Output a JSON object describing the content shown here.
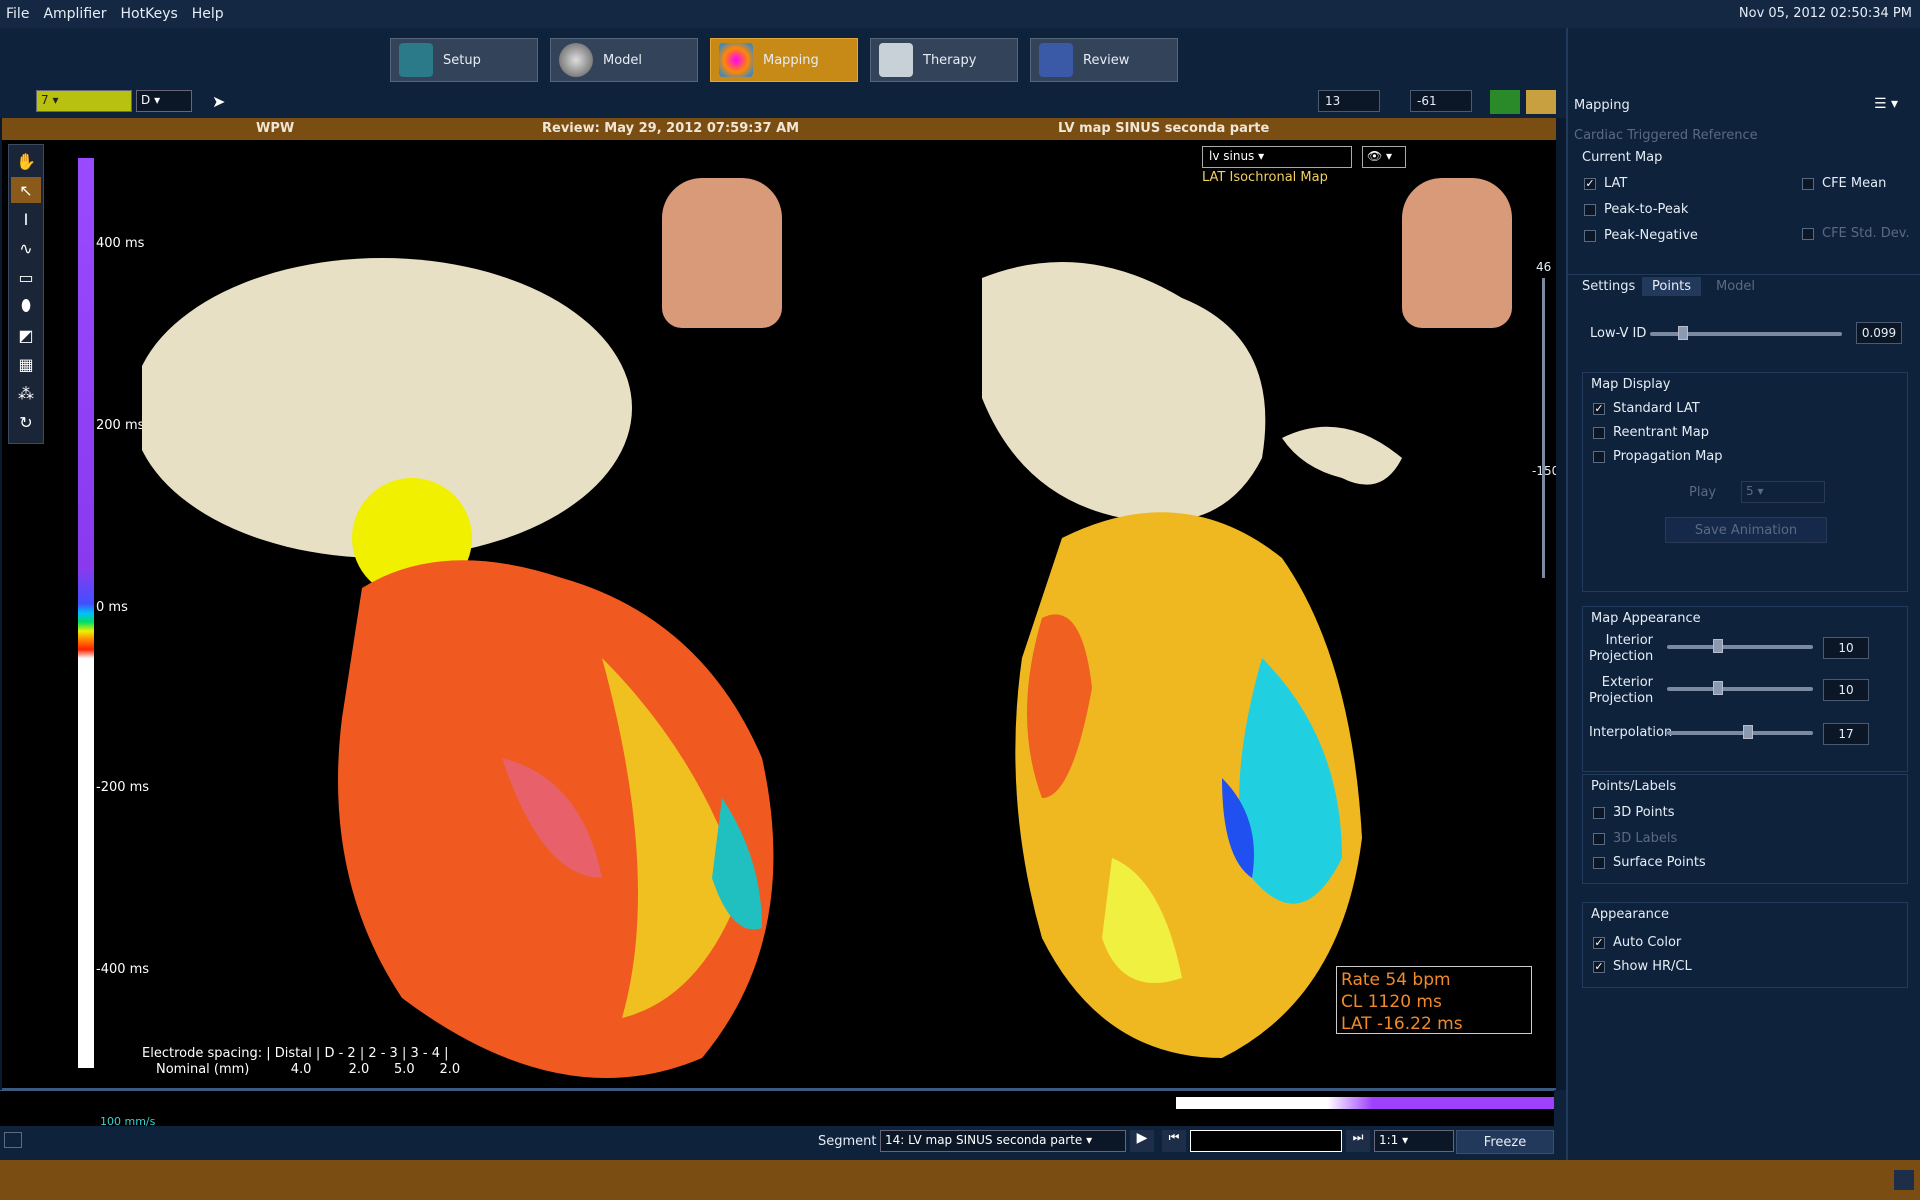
{
  "menu": [
    "File",
    "Amplifier",
    "HotKeys",
    "Help"
  ],
  "datetime": "Nov 05, 2012 02:50:34 PM",
  "tabs": [
    {
      "label": "Setup"
    },
    {
      "label": "Model"
    },
    {
      "label": "Mapping"
    },
    {
      "label": "Therapy"
    },
    {
      "label": "Review"
    }
  ],
  "toolbar": {
    "left_select": "7",
    "d_select": "D",
    "spin1": "13",
    "spin2": "-61"
  },
  "viewport": {
    "left_title": "WPW",
    "center_title": "Review: May 29, 2012 07:59:37 AM",
    "right_title": "LV map SINUS seconda parte",
    "map_select": "lv sinus",
    "map_label": "LAT Isochronal Map",
    "scale_ticks": [
      "400 ms",
      "200 ms",
      "0 ms",
      "-200 ms",
      "-400 ms"
    ],
    "side_vals": [
      "46",
      "-150"
    ],
    "rate": "Rate 54 bpm",
    "cl": "CL 1120 ms",
    "lat": "LAT -16.22 ms",
    "electrode_line1": "Electrode spacing: | Distal | D - 2 | 2 - 3 | 3 - 4 |",
    "electrode_line2": "Nominal (mm)          4.0         2.0      5.0      2.0"
  },
  "bottom": {
    "speed": "100 mm/s",
    "segment_label": "Segment",
    "segment_value": "14: LV map SINUS seconda parte",
    "ratio": "1:1",
    "freeze": "Freeze"
  },
  "panel": {
    "title": "Mapping",
    "ctr": "Cardiac Triggered Reference",
    "current_map": "Current Map",
    "lat": "LAT",
    "cfe_mean": "CFE Mean",
    "peak": "Peak-to-Peak",
    "cfe_std": "CFE Std. Dev.",
    "peakneg": "Peak-Negative",
    "tabs": [
      "Settings",
      "Points",
      "Model"
    ],
    "lowv": "Low-V ID",
    "lowv_val": "0.099",
    "map_display": "Map Display",
    "std_lat": "Standard LAT",
    "reentrant": "Reentrant Map",
    "propagation": "Propagation Map",
    "play": "Play",
    "play_val": "5",
    "save_anim": "Save Animation",
    "map_appearance": "Map Appearance",
    "interior": "Interior Projection",
    "interior_val": "10",
    "exterior": "Exterior Projection",
    "exterior_val": "10",
    "interp": "Interpolation",
    "interp_val": "17",
    "points_labels": "Points/Labels",
    "pts3d": "3D Points",
    "lbl3d": "3D Labels",
    "surf": "Surface Points",
    "appearance": "Appearance",
    "autocolor": "Auto Color",
    "showhr": "Show HR/CL"
  }
}
